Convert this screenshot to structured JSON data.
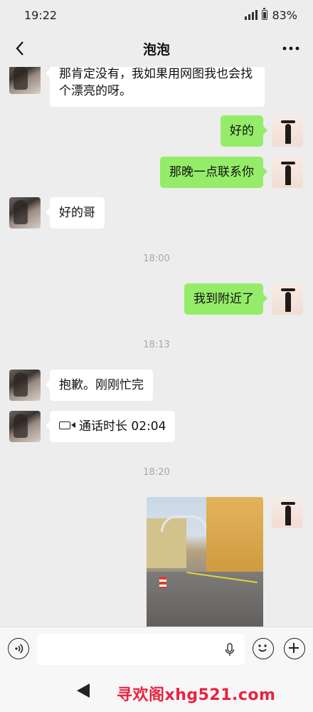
{
  "status_bar": {
    "time": "19:22",
    "battery": "83%"
  },
  "header": {
    "title": "泡泡"
  },
  "messages": [
    {
      "id": "m1",
      "side": "left",
      "text": "那肯定没有，我如果用网图我也会找个漂亮的呀。"
    },
    {
      "id": "m2",
      "side": "right",
      "text": "好的"
    },
    {
      "id": "m3",
      "side": "right",
      "text": "那晚一点联系你"
    },
    {
      "id": "m4",
      "side": "left",
      "text": "好的哥"
    },
    {
      "id": "t1",
      "type": "time",
      "text": "18:00"
    },
    {
      "id": "m5",
      "side": "right",
      "text": "我到附近了"
    },
    {
      "id": "t2",
      "type": "time",
      "text": "18:13"
    },
    {
      "id": "m6",
      "side": "left",
      "text": "抱歉。刚刚忙完"
    },
    {
      "id": "m7",
      "side": "left",
      "type": "call",
      "text": "通话时长 02:04",
      "icon": "video-call-icon"
    },
    {
      "id": "t3",
      "type": "time",
      "text": "18:20"
    },
    {
      "id": "m8",
      "side": "right",
      "type": "image",
      "icon": "photo-thumbnail"
    }
  ],
  "input_bar": {
    "voice_icon": "voice-toggle-icon",
    "mic_icon": "microphone-icon",
    "emoji_icon": "emoji-icon",
    "plus_icon": "plus-icon"
  },
  "watermark": "寻欢阁xhg521.com",
  "colors": {
    "self_bubble": "#95ec69",
    "other_bubble": "#ffffff",
    "background": "#ededed",
    "watermark": "#e8233e"
  }
}
